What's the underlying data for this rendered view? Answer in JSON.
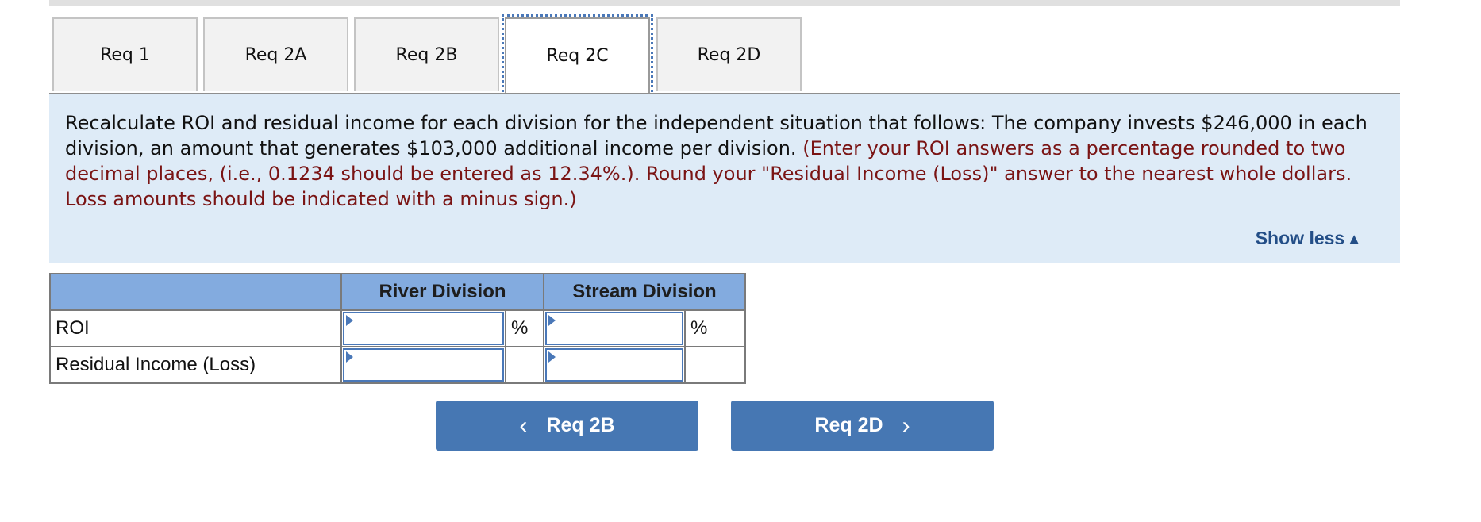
{
  "tabs": [
    {
      "label": "Req 1",
      "active": false
    },
    {
      "label": "Req 2A",
      "active": false
    },
    {
      "label": "Req 2B",
      "active": false
    },
    {
      "label": "Req 2C",
      "active": true
    },
    {
      "label": "Req 2D",
      "active": false
    }
  ],
  "instructions": {
    "main": "Recalculate ROI and residual income for each division for the independent situation that follows: The company invests $246,000 in each division, an amount that generates $103,000 additional income per division.",
    "note": "(Enter your ROI answers as a percentage rounded to two decimal places, (i.e., 0.1234 should be entered as 12.34%.). Round your \"Residual Income (Loss)\" answer to the nearest whole dollars. Loss amounts should be indicated with a minus sign.)",
    "show_less_label": "Show less",
    "show_less_icon": "▲"
  },
  "table": {
    "columns": [
      "",
      "River Division",
      "Stream Division"
    ],
    "rows": [
      {
        "label": "ROI",
        "river_value": "",
        "river_unit": "%",
        "stream_value": "",
        "stream_unit": "%"
      },
      {
        "label": "Residual Income (Loss)",
        "river_value": "",
        "river_unit": "",
        "stream_value": "",
        "stream_unit": ""
      }
    ]
  },
  "nav": {
    "prev_label": "Req 2B",
    "prev_icon": "‹",
    "next_label": "Req 2D",
    "next_icon": "›"
  },
  "colors": {
    "accent": "#4677b3",
    "panel_bg": "#deebf7",
    "note_text": "#7a1414",
    "header_bg": "#83abdf"
  }
}
